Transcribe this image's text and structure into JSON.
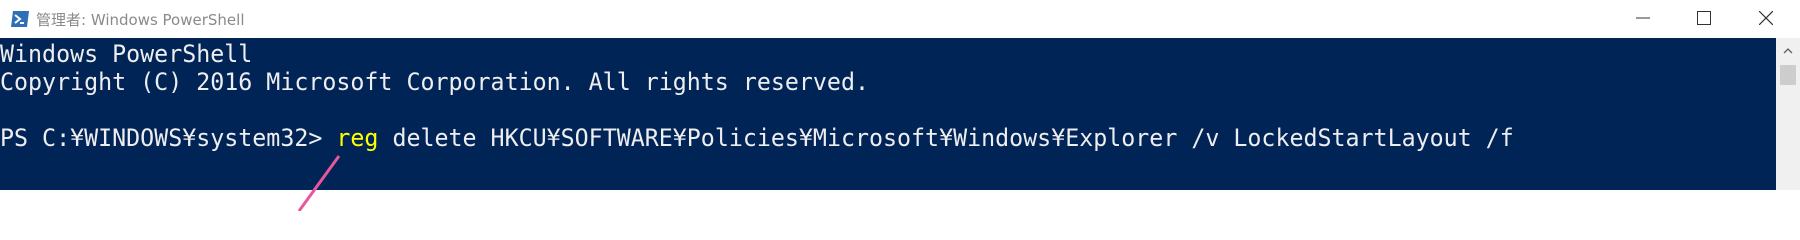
{
  "window": {
    "title": "管理者: Windows PowerShell",
    "app_icon": "powershell-icon",
    "buttons": {
      "minimize": "minimize-icon",
      "maximize": "maximize-icon",
      "close": "close-icon"
    }
  },
  "console": {
    "line1": "Windows PowerShell",
    "line2": "Copyright (C) 2016 Microsoft Corporation. All rights reserved.",
    "prompt": "PS C:¥WINDOWS¥system32> ",
    "command_keyword": "reg",
    "command_args": " delete HKCU¥SOFTWARE¥Policies¥Microsoft¥Windows¥Explorer /v LockedStartLayout /f",
    "background_color": "#012456",
    "text_color": "#eeedf0",
    "keyword_color": "#ffff00"
  },
  "annotation": {
    "pointer_color": "#e8579a"
  }
}
